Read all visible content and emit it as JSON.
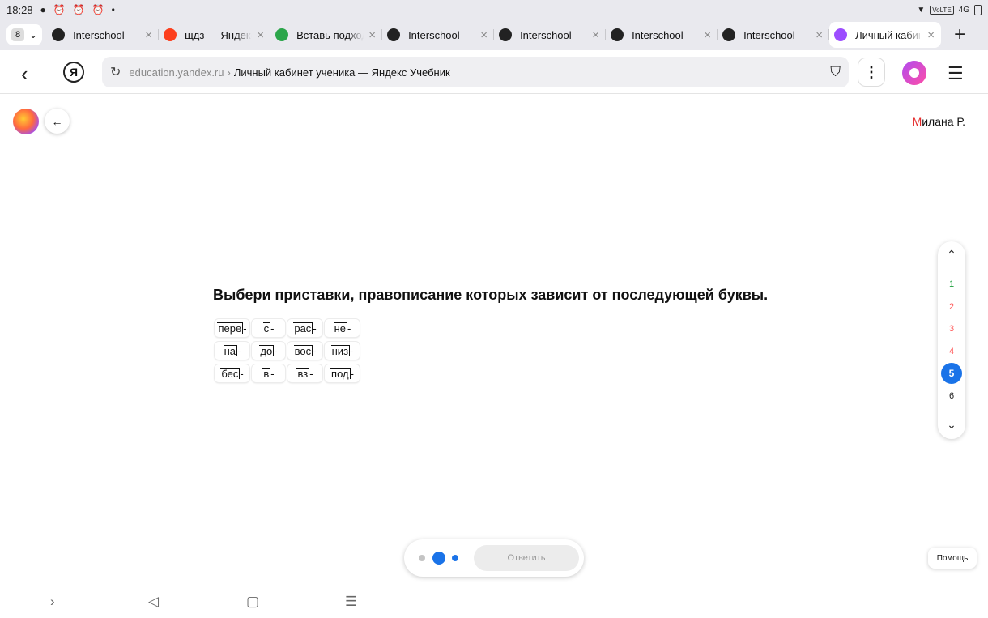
{
  "statusbar": {
    "time": "18:28",
    "network": "4G",
    "volte": "VoLTE"
  },
  "tabs": {
    "count": "8",
    "items": [
      {
        "label": "Interschool",
        "icon": "interschool-icon",
        "color": "#222222",
        "active": false
      },
      {
        "label": "щдз — Яндекс",
        "icon": "yandex-icon",
        "color": "#fc3f1d",
        "active": false
      },
      {
        "label": "Вставь подходящее",
        "icon": "gdz-icon",
        "color": "#2ba54a",
        "active": false
      },
      {
        "label": "Interschool",
        "icon": "interschool-icon",
        "color": "#222222",
        "active": false
      },
      {
        "label": "Interschool",
        "icon": "interschool-icon",
        "color": "#222222",
        "active": false
      },
      {
        "label": "Interschool",
        "icon": "interschool-icon",
        "color": "#222222",
        "active": false
      },
      {
        "label": "Interschool",
        "icon": "interschool-icon",
        "color": "#222222",
        "active": false
      },
      {
        "label": "Личный кабинет",
        "icon": "yandex-education-icon",
        "color": "#9c4dff",
        "active": true
      }
    ]
  },
  "address": {
    "domain": "education.yandex.ru",
    "separator": "›",
    "title": "Личный кабинет ученика — Яндекс Учебник"
  },
  "user": {
    "initial": "М",
    "rest": "илана Р."
  },
  "question": "Выбери приставки, правописание которых зависит от последующей буквы.",
  "prefixes": [
    [
      "пере",
      "с",
      "рас",
      "не"
    ],
    [
      "на",
      "до",
      "вос",
      "низ"
    ],
    [
      "бес",
      "в",
      "вз",
      "под"
    ]
  ],
  "question_nav": [
    {
      "num": "1",
      "state": "done"
    },
    {
      "num": "2",
      "state": "wrong"
    },
    {
      "num": "3",
      "state": "wrong"
    },
    {
      "num": "4",
      "state": "wrong"
    },
    {
      "num": "5",
      "state": "current"
    },
    {
      "num": "6",
      "state": "todo"
    }
  ],
  "answer_label": "Ответить",
  "help_label": "Помощь",
  "colors": {
    "accent": "#1a73e8",
    "done": "#1a9e3a",
    "wrong": "#ff5a5a",
    "user_initial": "#e52b2b"
  }
}
